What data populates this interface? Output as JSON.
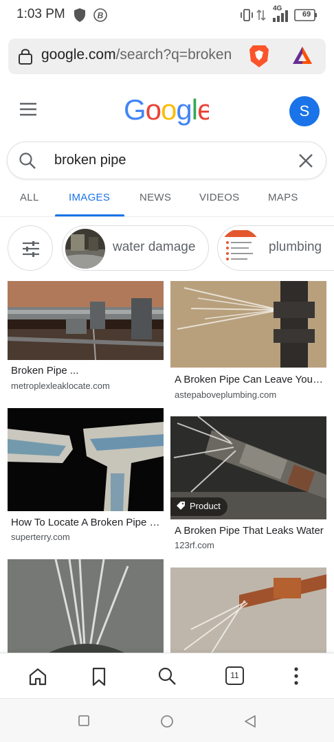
{
  "status": {
    "time": "1:03 PM",
    "network": "4G",
    "battery": "69"
  },
  "browser": {
    "url_host": "google.com",
    "url_path": "/search?q=broken",
    "tab_count": "11"
  },
  "header": {
    "logo": "Google",
    "avatar_letter": "S"
  },
  "search": {
    "query": "broken pipe"
  },
  "tabs": [
    {
      "label": "ALL",
      "active": false
    },
    {
      "label": "IMAGES",
      "active": true
    },
    {
      "label": "NEWS",
      "active": false
    },
    {
      "label": "VIDEOS",
      "active": false
    },
    {
      "label": "MAPS",
      "active": false
    }
  ],
  "chips": [
    {
      "label": "water damage"
    },
    {
      "label": "plumbing"
    }
  ],
  "results": [
    {
      "title": "Broken Pipe ...",
      "source": "metroplexleaklocate.com"
    },
    {
      "title": "A Broken Pipe Can Leave You Feeling",
      "source": "astepaboveplumbing.com"
    },
    {
      "title": "How To Locate A Broken Pipe Underground",
      "source": "superterry.com"
    },
    {
      "title": "A Broken Pipe That Leaks Water",
      "source": "123rf.com",
      "badge": "Product"
    }
  ],
  "colors": {
    "accent": "#1a73e8",
    "google_blue": "#4285f4",
    "google_red": "#ea4335",
    "google_yellow": "#fbbc05",
    "google_green": "#34a853"
  }
}
